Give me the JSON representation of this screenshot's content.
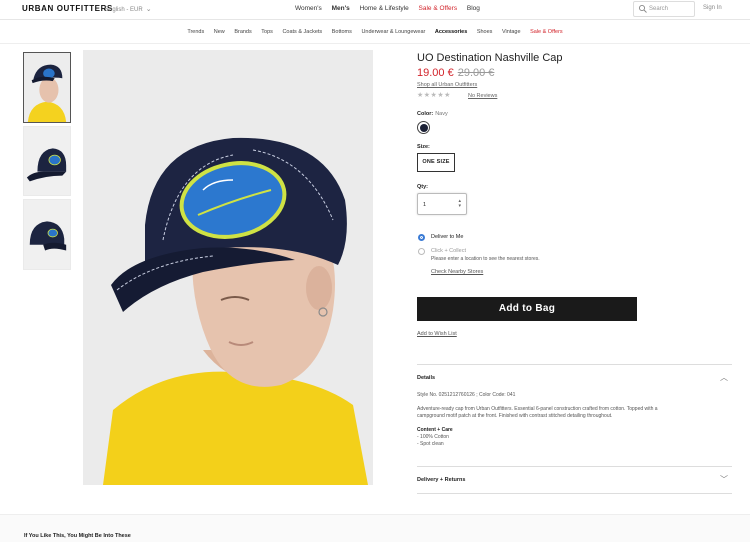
{
  "header": {
    "logo": "URBAN OUTFITTERS",
    "locale": "English - EUR",
    "nav": [
      "Women's",
      "Men's",
      "Home & Lifestyle",
      "Sale & Offers",
      "Blog"
    ],
    "search_placeholder": "Search",
    "signin": "Sign In"
  },
  "subnav": [
    "Trends",
    "New",
    "Brands",
    "Tops",
    "Coats & Jackets",
    "Bottoms",
    "Underwear & Loungewear",
    "Accessories",
    "Shoes",
    "Vintage",
    "Sale & Offers"
  ],
  "product": {
    "title": "UO Destination Nashville Cap",
    "price_now": "19.00 €",
    "price_was": "29.00 €",
    "shop_all": "Shop all Urban Outfitters",
    "stars": "★★★★★",
    "reviews": "No Reviews",
    "color_label": "Color:",
    "color_value": "Navy",
    "color_hex": "#1c2136",
    "size_label": "Size:",
    "size_value": "ONE SIZE",
    "qty_label": "Qty:",
    "qty_value": "1",
    "deliver_to_me": "Deliver to Me",
    "click_collect": "Click + Collect",
    "collect_note": "Please enter a location to see the nearest stores.",
    "check_stores": "Check Nearby Stores",
    "add_to_bag": "Add to Bag",
    "wishlist": "Add to Wish List"
  },
  "details": {
    "title": "Details",
    "style_no": "Style No. 0251212760126 ; Color Code: 041",
    "desc_line1": "Adventure-ready cap from Urban Outfitters. Essential 6-panel construction crafted from cotton. Topped with a",
    "desc_line2": "campground motif patch at the front. Finished with contrast stitched detailing throughout.",
    "care_title": "Content + Care",
    "care_items": [
      "- 100% Cotton",
      "- Spot clean"
    ]
  },
  "delivery_returns": "Delivery + Returns",
  "recommend_title": "If You Like This, You Might Be Into These",
  "colors": {
    "sale": "#d2232a",
    "accent_blue": "#3a7bd5",
    "button": "#1a1a1a"
  }
}
